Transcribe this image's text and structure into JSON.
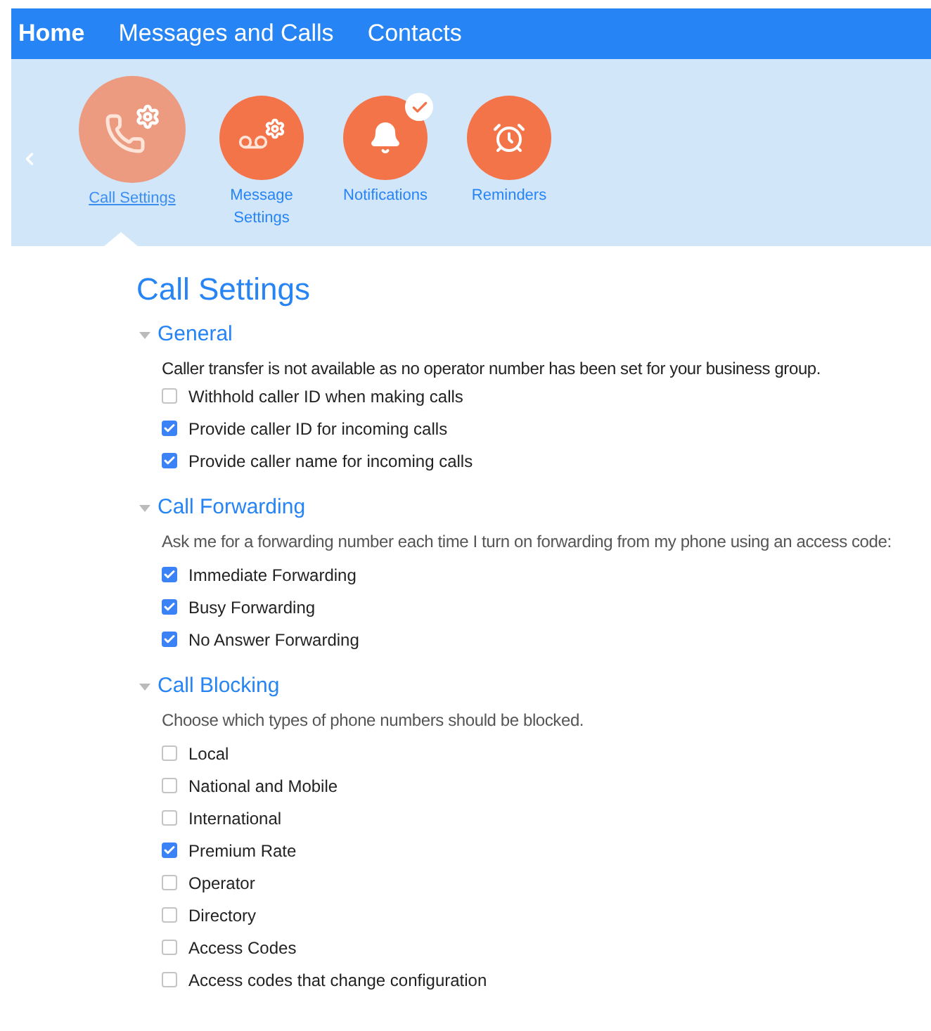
{
  "nav": [
    {
      "label": "Home",
      "selected": true
    },
    {
      "label": "Messages and Calls",
      "selected": false
    },
    {
      "label": "Contacts",
      "selected": false
    }
  ],
  "tiles": [
    {
      "kind": "phone",
      "label": "Call Settings",
      "selected": true,
      "badge": false
    },
    {
      "kind": "voicemail",
      "label": "Message Settings",
      "selected": false,
      "badge": false
    },
    {
      "kind": "bell",
      "label": "Notifications",
      "selected": false,
      "badge": true
    },
    {
      "kind": "alarm",
      "label": "Reminders",
      "selected": false,
      "badge": false
    }
  ],
  "page_title": "Call Settings",
  "sections": [
    {
      "title": "General",
      "expanded": true,
      "description": "Caller transfer is not available as no operator number has been set for your business group.",
      "options": [
        {
          "label": "Withhold caller ID when making calls",
          "checked": false
        },
        {
          "label": "Provide caller ID for incoming calls",
          "checked": true
        },
        {
          "label": "Provide caller name for incoming calls",
          "checked": true
        }
      ]
    },
    {
      "title": "Call Forwarding",
      "expanded": true,
      "description": "Ask me for a forwarding number each time I turn on forwarding from my phone using an access code:",
      "options": [
        {
          "label": "Immediate Forwarding",
          "checked": true
        },
        {
          "label": "Busy Forwarding",
          "checked": true
        },
        {
          "label": "No Answer Forwarding",
          "checked": true
        }
      ]
    },
    {
      "title": "Call Blocking",
      "expanded": true,
      "description": "Choose which types of phone numbers should be blocked.",
      "options": [
        {
          "label": "Local",
          "checked": false
        },
        {
          "label": "National and Mobile",
          "checked": false
        },
        {
          "label": "International",
          "checked": false
        },
        {
          "label": "Premium Rate",
          "checked": true
        },
        {
          "label": "Operator",
          "checked": false
        },
        {
          "label": "Directory",
          "checked": false
        },
        {
          "label": "Access Codes",
          "checked": false
        },
        {
          "label": "Access codes that change configuration",
          "checked": false
        }
      ]
    }
  ]
}
